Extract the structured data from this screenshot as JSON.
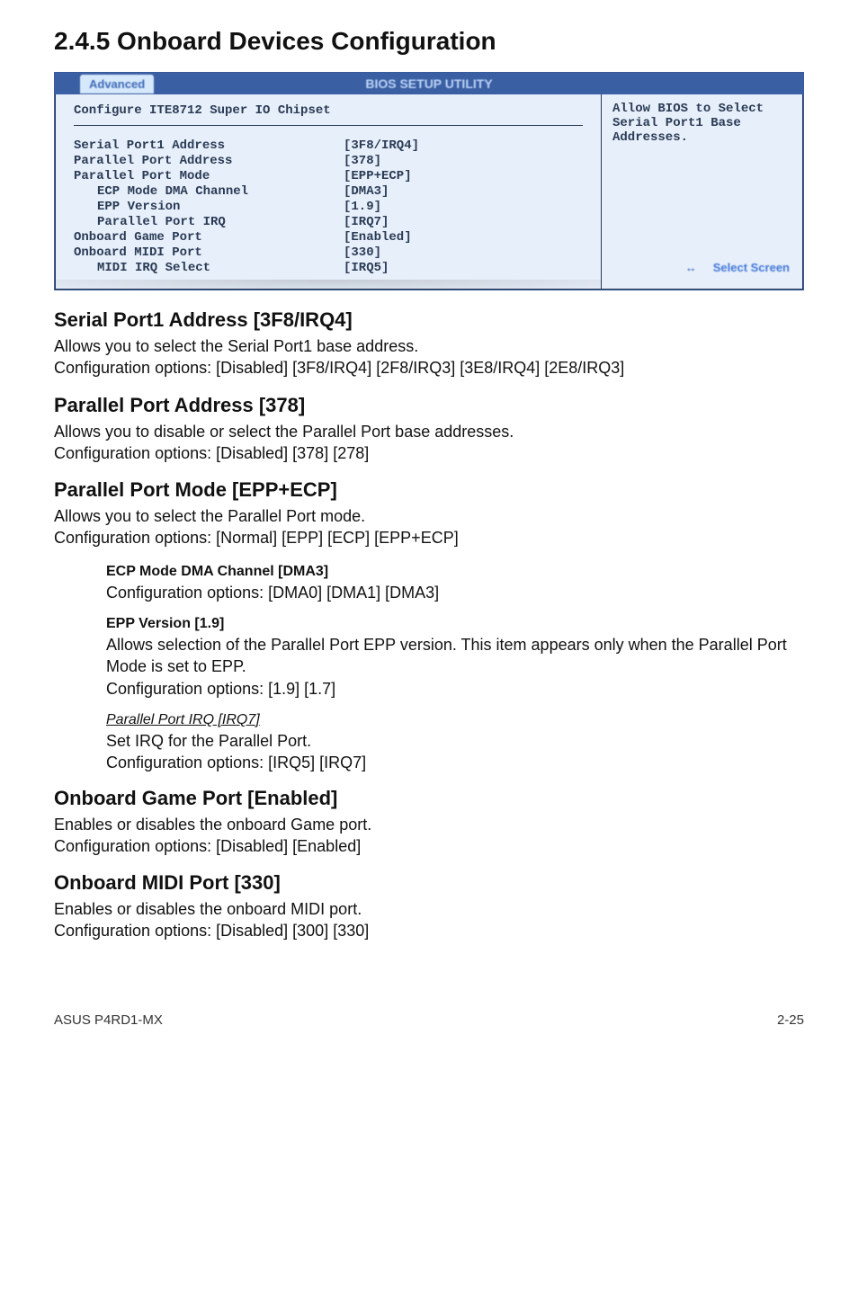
{
  "section_title": "2.4.5  Onboard Devices Configuration",
  "bios": {
    "tab": "Advanced",
    "header": "BIOS SETUP UTILITY",
    "chipset": "Configure ITE8712 Super IO Chipset",
    "rows": [
      {
        "label": "Serial Port1 Address",
        "value": "[3F8/IRQ4]",
        "indent": false
      },
      {
        "label": "Parallel Port Address",
        "value": "[378]",
        "indent": false
      },
      {
        "label": "Parallel Port Mode",
        "value": "[EPP+ECP]",
        "indent": false
      },
      {
        "label": "ECP Mode DMA Channel",
        "value": "[DMA3]",
        "indent": true
      },
      {
        "label": "EPP Version",
        "value": "[1.9]",
        "indent": true
      },
      {
        "label": "Parallel Port IRQ",
        "value": "[IRQ7]",
        "indent": true
      },
      {
        "label": "Onboard Game Port",
        "value": "[Enabled]",
        "indent": false
      },
      {
        "label": "Onboard MIDI Port",
        "value": "[330]",
        "indent": false
      },
      {
        "label": "MIDI IRQ Select",
        "value": "[IRQ5]",
        "indent": true
      }
    ],
    "help": {
      "line1": "Allow BIOS to Select",
      "line2": "Serial Port1 Base",
      "line3": "Addresses."
    },
    "nav": "Select Screen"
  },
  "serial": {
    "title": "Serial Port1 Address [3F8/IRQ4]",
    "body": "Allows you to select the Serial Port1 base address.\nConfiguration options: [Disabled] [3F8/IRQ4] [2F8/IRQ3] [3E8/IRQ4] [2E8/IRQ3]"
  },
  "paddr": {
    "title": "Parallel Port Address [378]",
    "body": "Allows you to disable or select the Parallel Port base addresses.\nConfiguration options: [Disabled] [378] [278]"
  },
  "pmode": {
    "title": "Parallel Port Mode [EPP+ECP]",
    "body": "Allows you to select the Parallel Port  mode.\nConfiguration options: [Normal] [EPP] [ECP] [EPP+ECP]",
    "ecp_title": "ECP Mode DMA Channel [DMA3]",
    "ecp_body": "Configuration options: [DMA0] [DMA1] [DMA3]",
    "epp_title": "EPP Version [1.9]",
    "epp_body": "Allows selection of the Parallel Port EPP version. This item appears only when the Parallel Port Mode is set to EPP.\nConfiguration options: [1.9] [1.7]",
    "irq_title": "Parallel Port IRQ [IRQ7]",
    "irq_body": "Set IRQ for the Parallel Port.\nConfiguration options: [IRQ5] [IRQ7]"
  },
  "game": {
    "title": "Onboard Game Port [Enabled]",
    "body": "Enables or disables the onboard Game port.\nConfiguration options: [Disabled] [Enabled]"
  },
  "midi": {
    "title": "Onboard MIDI Port [330]",
    "body": "Enables or disables the onboard MIDI port.\nConfiguration options: [Disabled] [300] [330]"
  },
  "footer": {
    "left": "ASUS P4RD1-MX",
    "right": "2-25"
  }
}
